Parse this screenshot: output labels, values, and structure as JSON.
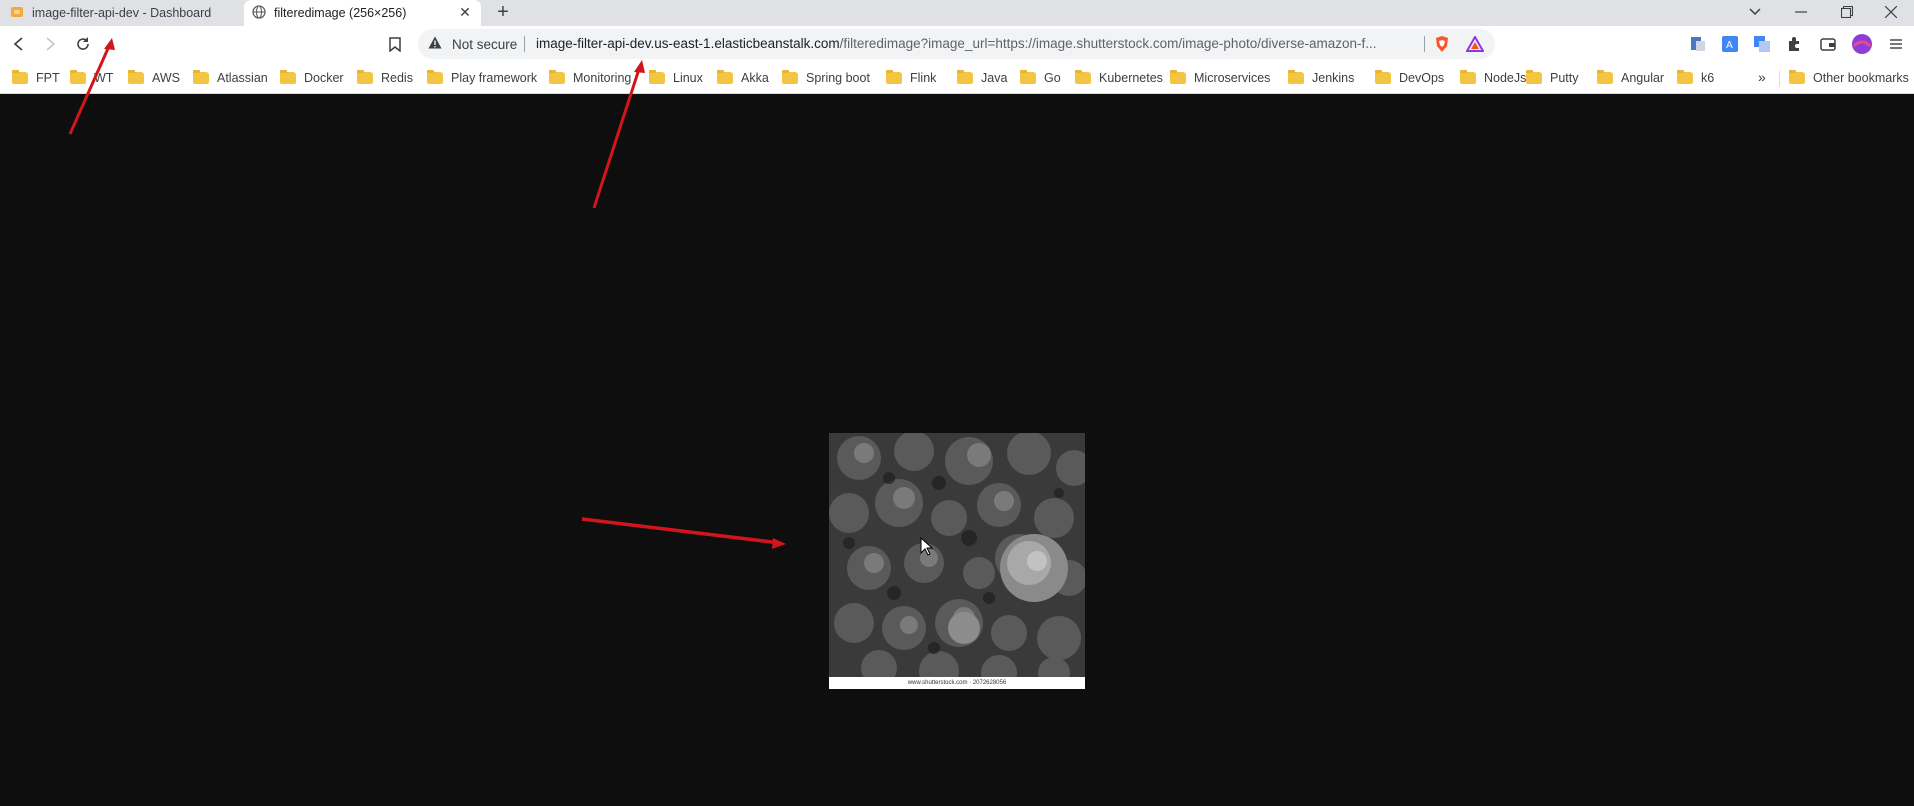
{
  "tabs": [
    {
      "title": "image-filter-api-dev - Dashboard",
      "active": false
    },
    {
      "title": "filteredimage (256×256)",
      "active": true
    }
  ],
  "new_tab_symbol": "+",
  "omnibox": {
    "security_label": "Not secure",
    "url_host": "image-filter-api-dev.us-east-1.elasticbeanstalk.com",
    "url_path": "/filteredimage?image_url=https://image.shutterstock.com/image-photo/diverse-amazon-f..."
  },
  "bookmarks": [
    {
      "label": "FPT"
    },
    {
      "label": "WT"
    },
    {
      "label": "AWS"
    },
    {
      "label": "Atlassian"
    },
    {
      "label": "Docker"
    },
    {
      "label": "Redis"
    },
    {
      "label": "Play framework"
    },
    {
      "label": "Monitoring"
    },
    {
      "label": "Linux"
    },
    {
      "label": "Akka"
    },
    {
      "label": "Spring boot"
    },
    {
      "label": "Flink"
    },
    {
      "label": "Java"
    },
    {
      "label": "Go"
    },
    {
      "label": "Kubernetes"
    },
    {
      "label": "Microservices"
    },
    {
      "label": "Jenkins"
    },
    {
      "label": "DevOps"
    },
    {
      "label": "NodeJs"
    },
    {
      "label": "Putty"
    },
    {
      "label": "Angular"
    },
    {
      "label": "k6"
    }
  ],
  "more_bookmarks_symbol": "»",
  "other_bookmarks": "Other bookmarks",
  "image": {
    "watermark_caption": "www.shutterstock.com · 2072628056"
  },
  "colors": {
    "page_background": "#0e0e0e",
    "annotation_arrow": "#d0161b",
    "tabstrip": "#dfe1e5"
  }
}
